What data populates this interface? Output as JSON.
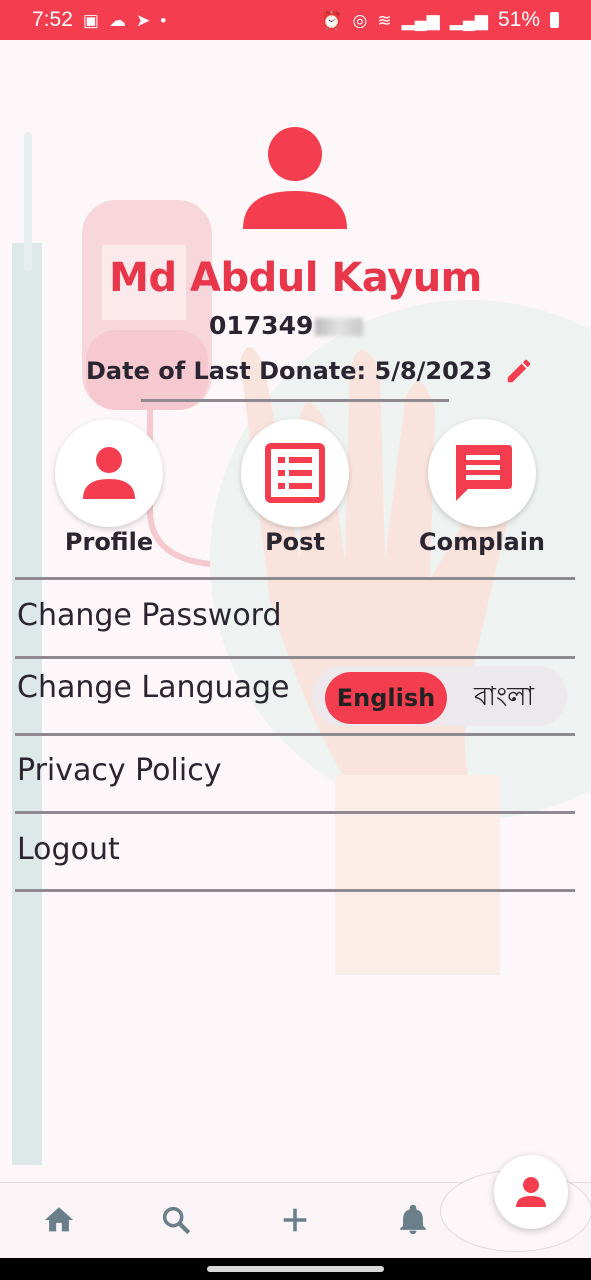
{
  "status_bar": {
    "time": "7:52",
    "battery": "51%",
    "left_icons": [
      "image-icon",
      "weather-icon",
      "plane-icon",
      "dot-icon"
    ],
    "right_icons": [
      "alarm-icon",
      "hotspot-icon",
      "wifi-icon",
      "signal-icon",
      "signal-icon"
    ]
  },
  "profile": {
    "name": "Md Abdul Kayum",
    "phone_visible": "017349",
    "last_donate_label": "Date of Last Donate: 5/8/2023"
  },
  "quick_actions": [
    {
      "label": "Profile",
      "icon": "person-icon"
    },
    {
      "label": "Post",
      "icon": "list-icon"
    },
    {
      "label": "Complain",
      "icon": "chat-icon"
    }
  ],
  "menu": {
    "change_password": "Change Password",
    "change_language": "Change Language",
    "privacy_policy": "Privacy Policy",
    "logout": "Logout"
  },
  "language": {
    "english": "English",
    "bangla": "বাংলা",
    "selected": "English"
  },
  "bottom_nav": [
    "home-icon",
    "search-icon",
    "add-icon",
    "bell-icon",
    "profile-icon"
  ],
  "colors": {
    "accent": "#f43d4e",
    "text": "#2a2530",
    "divider": "#8e8a8f"
  }
}
